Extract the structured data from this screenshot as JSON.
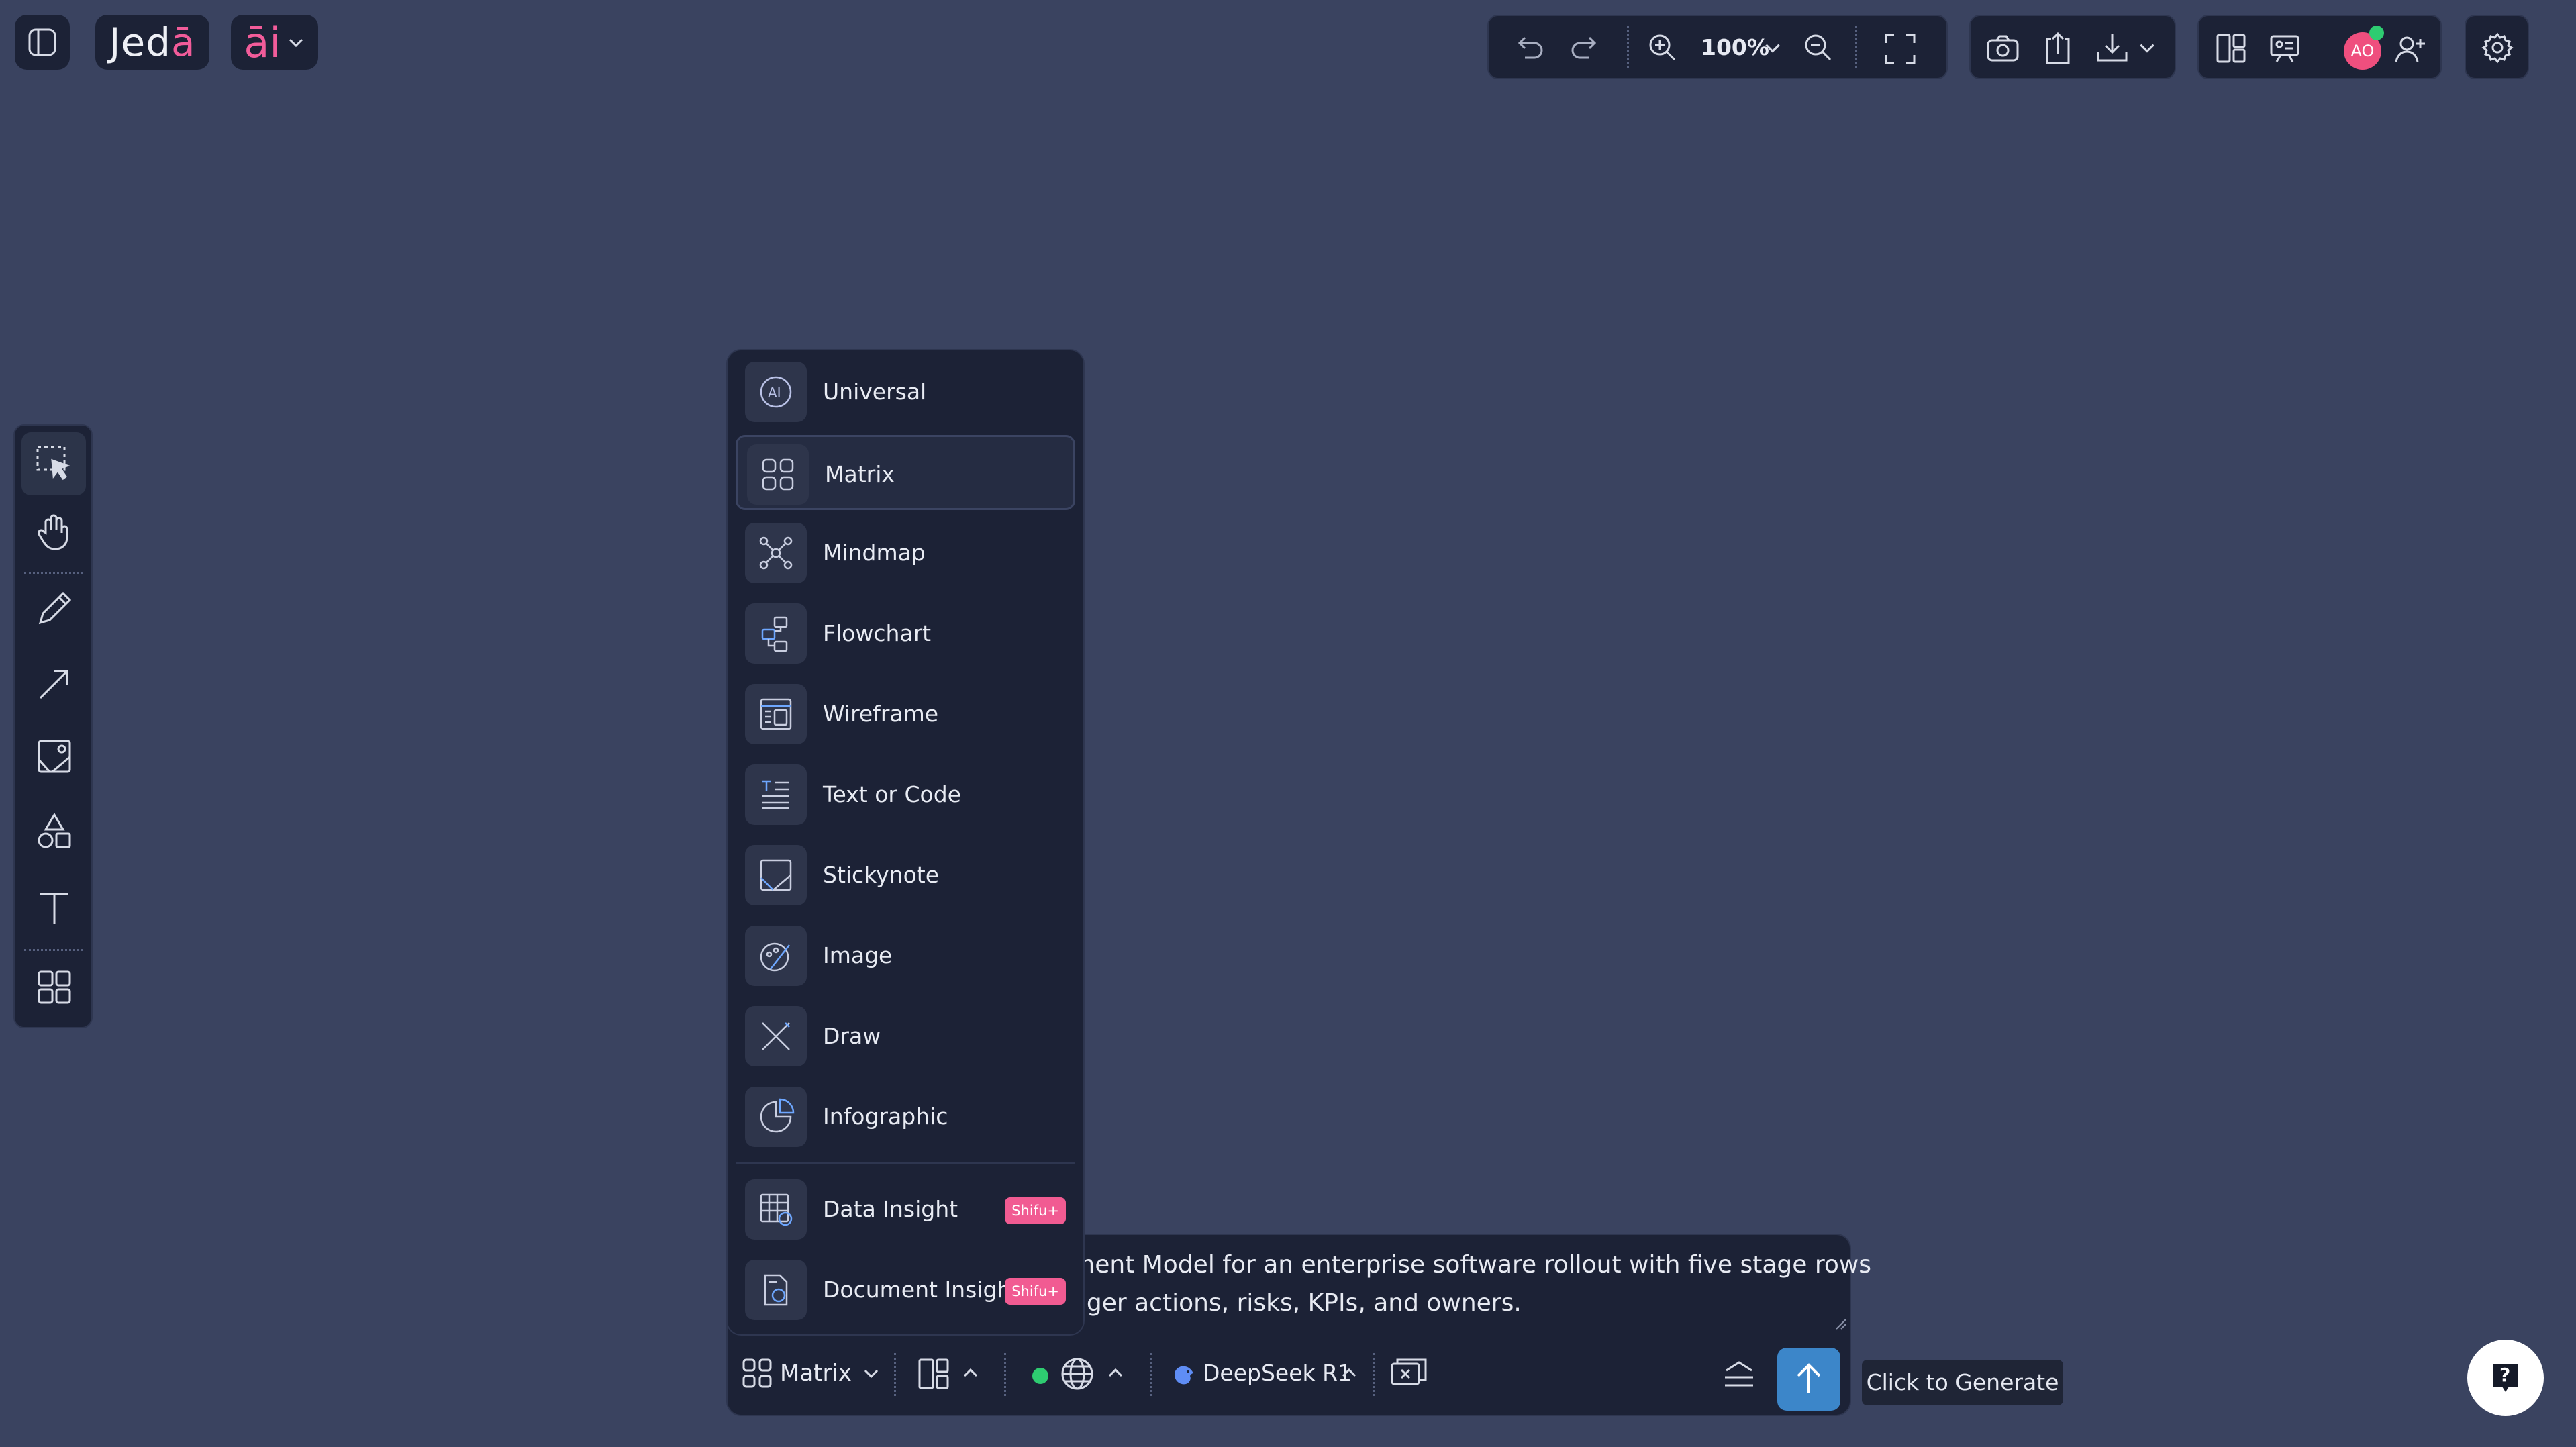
{
  "app": {
    "brand_prefix": "Jed",
    "brand_accent": "ā",
    "ai_label": "āi"
  },
  "toolbar": {
    "zoom_level": "100%",
    "avatar_initials": "AO"
  },
  "mode_menu": {
    "items": [
      {
        "label": "Universal",
        "icon": "ai-circle-icon"
      },
      {
        "label": "Matrix",
        "icon": "grid-icon",
        "selected": true
      },
      {
        "label": "Mindmap",
        "icon": "mindmap-icon"
      },
      {
        "label": "Flowchart",
        "icon": "flowchart-icon"
      },
      {
        "label": "Wireframe",
        "icon": "wireframe-icon"
      },
      {
        "label": "Text or Code",
        "icon": "text-icon"
      },
      {
        "label": "Stickynote",
        "icon": "stickynote-icon"
      },
      {
        "label": "Image",
        "icon": "image-icon"
      },
      {
        "label": "Draw",
        "icon": "draw-icon"
      },
      {
        "label": "Infographic",
        "icon": "infographic-icon"
      }
    ],
    "premium_items": [
      {
        "label": "Data Insight",
        "badge": "Shifu+",
        "icon": "data-insight-icon"
      },
      {
        "label": "Document Insight",
        "badge": "Shifu+",
        "icon": "document-insight-icon"
      }
    ]
  },
  "prompt": {
    "text_line1": "ement Model for an enterprise software rollout with five stage rows",
    "text_line2": "nager actions, risks, KPIs, and owners.",
    "mode_label": "Matrix",
    "model_label": "DeepSeek R1",
    "send_tooltip": "Click to Generate"
  },
  "colors": {
    "background": "#3a4360",
    "panel": "#1c2236",
    "accent_pink": "#f25c9a",
    "send_blue": "#3c86c9",
    "status_green": "#2ecc71"
  }
}
